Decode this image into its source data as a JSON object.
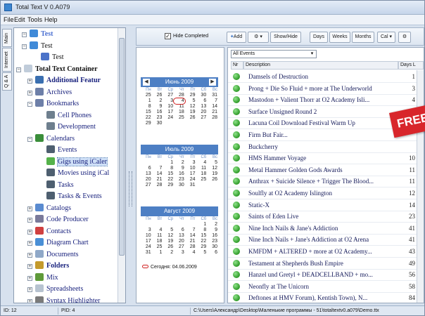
{
  "window": {
    "title": "Total Text V 0.A079"
  },
  "menu": [
    "File",
    "Edit",
    "Tools",
    "Help"
  ],
  "vtabs": [
    "Main",
    "Internet",
    "Q & A"
  ],
  "tree": {
    "items": [
      {
        "label": "Test",
        "style": "bold",
        "color": "#4a6fd1"
      },
      {
        "label": "Test",
        "style": "plain",
        "color": "#111111"
      },
      {
        "label": "Test",
        "style": "plain",
        "color": "#111111"
      },
      {
        "label": "Total Text Container",
        "style": "bold",
        "color": "#111111"
      },
      {
        "label": "Additional Featur",
        "style": "bold",
        "color": "#1a237e"
      },
      {
        "label": "Archives",
        "style": "plain",
        "color": "#1a237e"
      },
      {
        "label": "Bookmarks",
        "style": "plain",
        "color": "#1a237e"
      },
      {
        "label": "Cell Phones",
        "style": "plain",
        "color": "#1a237e"
      },
      {
        "label": "Development",
        "style": "plain",
        "color": "#1a237e"
      },
      {
        "label": "Calendars",
        "style": "plain",
        "color": "#1a237e"
      },
      {
        "label": "Events",
        "style": "plain",
        "color": "#1a237e"
      },
      {
        "label": "Gigs using iCaler",
        "style": "plain",
        "color": "#1a237e"
      },
      {
        "label": "Movies using iCal",
        "style": "plain",
        "color": "#1a237e"
      },
      {
        "label": "Tasks",
        "style": "plain",
        "color": "#1a237e"
      },
      {
        "label": "Tasks & Events",
        "style": "plain",
        "color": "#1a237e"
      },
      {
        "label": "Catalogs",
        "style": "plain",
        "color": "#1a237e"
      },
      {
        "label": "Code Producer",
        "style": "plain",
        "color": "#1a237e"
      },
      {
        "label": "Contacts",
        "style": "plain",
        "color": "#1a237e"
      },
      {
        "label": "Diagram Chart",
        "style": "plain",
        "color": "#1a237e"
      },
      {
        "label": "Documents",
        "style": "plain",
        "color": "#1a237e"
      },
      {
        "label": "Folders",
        "style": "bold",
        "color": "#1a237e"
      },
      {
        "label": "Mix",
        "style": "plain",
        "color": "#1a237e"
      },
      {
        "label": "Spreadsheets",
        "style": "plain",
        "color": "#1a237e"
      },
      {
        "label": "Syntax Highlighter",
        "style": "plain",
        "color": "#1a237e"
      }
    ]
  },
  "toolbar": {
    "hide_completed": "Hide Completed",
    "add": "Add",
    "showhide": "Show/Hide",
    "days": "Days",
    "weeks": "Weeks",
    "months": "Months",
    "cal": "Cal"
  },
  "calendars": [
    {
      "month": "Июнь 2009",
      "dow": [
        "Пн",
        "Вт",
        "Ср",
        "Чт",
        "Пт",
        "Сб",
        "Вс"
      ],
      "weeks": [
        [
          "25",
          "26",
          "27",
          "28",
          "29",
          "30",
          "31"
        ],
        [
          "1",
          "2",
          "3",
          "4",
          "5",
          "6",
          "7"
        ],
        [
          "8",
          "9",
          "10",
          "11",
          "12",
          "13",
          "14"
        ],
        [
          "15",
          "16",
          "17",
          "18",
          "19",
          "20",
          "21"
        ],
        [
          "22",
          "23",
          "24",
          "25",
          "26",
          "27",
          "28"
        ],
        [
          "29",
          "30",
          "",
          "",
          "",
          "",
          ""
        ]
      ]
    },
    {
      "month": "Июль 2009",
      "dow": [
        "Пн",
        "Вт",
        "Ср",
        "Чт",
        "Пт",
        "Сб",
        "Вс"
      ],
      "weeks": [
        [
          "",
          "",
          "1",
          "2",
          "3",
          "4",
          "5"
        ],
        [
          "6",
          "7",
          "8",
          "9",
          "10",
          "11",
          "12"
        ],
        [
          "13",
          "14",
          "15",
          "16",
          "17",
          "18",
          "19"
        ],
        [
          "20",
          "21",
          "22",
          "23",
          "24",
          "25",
          "26"
        ],
        [
          "27",
          "28",
          "29",
          "30",
          "31",
          "",
          ""
        ]
      ]
    },
    {
      "month": "Август 2009",
      "dow": [
        "Пн",
        "Вт",
        "Ср",
        "Чт",
        "Пт",
        "Сб",
        "Вс"
      ],
      "weeks": [
        [
          "",
          "",
          "",
          "",
          "",
          "1",
          "2"
        ],
        [
          "3",
          "4",
          "5",
          "6",
          "7",
          "8",
          "9"
        ],
        [
          "10",
          "11",
          "12",
          "13",
          "14",
          "15",
          "16"
        ],
        [
          "17",
          "18",
          "19",
          "20",
          "21",
          "22",
          "23"
        ],
        [
          "24",
          "25",
          "26",
          "27",
          "28",
          "29",
          "30"
        ],
        [
          "31",
          "1",
          "2",
          "3",
          "4",
          "5",
          "6"
        ]
      ]
    }
  ],
  "today_label": "Сегодня: 04.06.2009",
  "events_panel": {
    "filter": "All Events",
    "columns": {
      "nr": "Nr",
      "description": "Description",
      "days": "Days L"
    },
    "rows": [
      {
        "title": "Damsels of Destruction",
        "days": "1"
      },
      {
        "title": "Prong + Die So Fluid + more at The Underworld",
        "days": "3"
      },
      {
        "title": "Mastodon + Valient Thorr at O2 Academy Isli...",
        "days": "4"
      },
      {
        "title": "Surface Unsigned Round 2",
        "days": "6"
      },
      {
        "title": "Lacuna Coil Download Festival Warm Up",
        "days": ""
      },
      {
        "title": "Firm But Fair...",
        "days": ""
      },
      {
        "title": "Buckcherry",
        "days": ""
      },
      {
        "title": "HMS Hammer Voyage",
        "days": "10"
      },
      {
        "title": "Metal Hammer Golden Gods Awards",
        "days": "11"
      },
      {
        "title": "Anthrax + Suicide Silence + Trigger The Blood...",
        "days": "11"
      },
      {
        "title": "Soulfly at O2 Academy Islington",
        "days": "12"
      },
      {
        "title": "Static-X",
        "days": "14"
      },
      {
        "title": "Saints of Eden Live",
        "days": "23"
      },
      {
        "title": "Nine Inch Nails & Jane's Addiction",
        "days": "41"
      },
      {
        "title": "Nine Inch Nails + Jane's Addiction at O2 Arena",
        "days": "41"
      },
      {
        "title": "KMFDM + ALTERED + more at O2 Academy...",
        "days": "43"
      },
      {
        "title": "Testament at Shepherds Bush Empire",
        "days": "49"
      },
      {
        "title": "Hanzel und Gretyl + DEADCELLBAND + mo...",
        "days": "56"
      },
      {
        "title": "Neonfly at The Unicorn",
        "days": "58"
      },
      {
        "title": "Deftones at HMV Forum), Kentish Town), N...",
        "days": "84"
      }
    ]
  },
  "banner": "FREE",
  "status": {
    "id": "ID: 12",
    "pid": "PID: 4",
    "path": "C:\\Users\\Александр\\Desktop\\Маленькие программы - 51\\totaltextv0.a079\\Demo.ttx"
  }
}
